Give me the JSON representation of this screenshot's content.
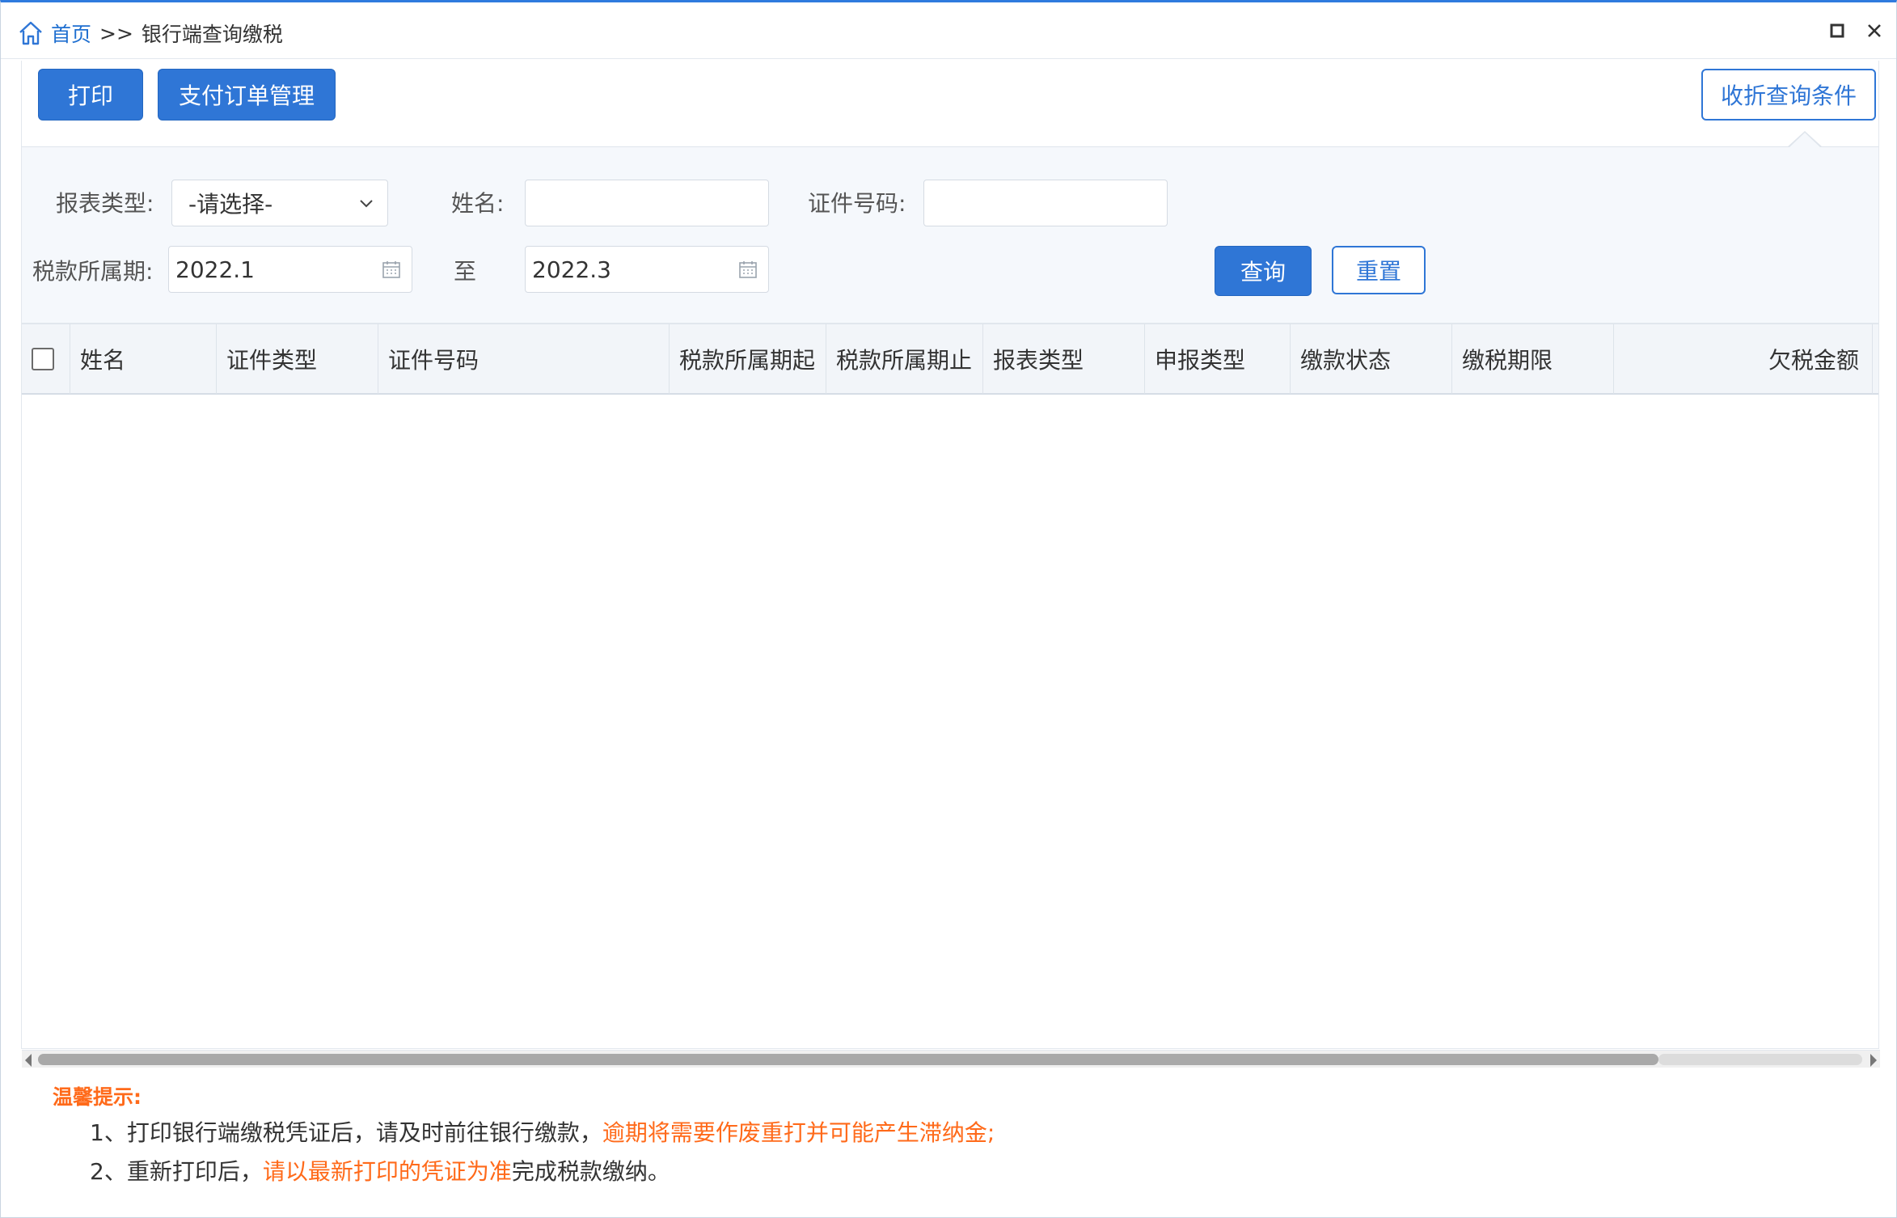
{
  "breadcrumb": {
    "home": "首页",
    "separator": ">>",
    "current": "银行端查询缴税"
  },
  "toolbar": {
    "print_label": "打印",
    "order_mgmt_label": "支付订单管理",
    "collapse_label": "收折查询条件"
  },
  "query": {
    "report_type_label": "报表类型:",
    "report_type_value": "-请选择-",
    "name_label": "姓名:",
    "name_value": "",
    "id_no_label": "证件号码:",
    "id_no_value": "",
    "tax_period_label": "税款所属期:",
    "period_start": "2022.1",
    "to_label": "至",
    "period_end": "2022.3",
    "search_label": "查询",
    "reset_label": "重置"
  },
  "grid": {
    "columns": [
      "姓名",
      "证件类型",
      "证件号码",
      "税款所属期起",
      "税款所属期止",
      "报表类型",
      "申报类型",
      "缴款状态",
      "缴税期限",
      "欠税金额"
    ],
    "rows": []
  },
  "notes": {
    "title": "温馨提示:",
    "line1_prefix": "1、打印银行端缴税凭证后，请及时前往银行缴款，",
    "line1_warning": "逾期将需要作废重打并可能产生滞纳金;",
    "line2_prefix": "2、重新打印后，",
    "line2_warning": "请以最新打印的凭证为准",
    "line2_suffix": "完成税款缴纳。"
  },
  "colors": {
    "primary": "#2f76d6",
    "warning": "#ff6a1a",
    "panel_bg": "#f5f8fc"
  },
  "icons": {
    "home": "home-icon",
    "restore": "restore-icon",
    "close": "close-icon",
    "dropdown": "chevron-down-icon",
    "calendar": "calendar-icon"
  }
}
